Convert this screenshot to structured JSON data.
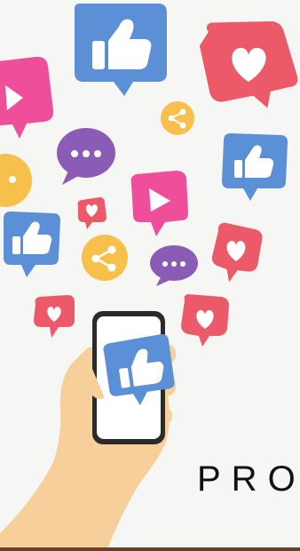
{
  "title": "PRO",
  "colors": {
    "background": "#f6f6f4",
    "blue": "#5b8fd6",
    "red": "#ec5a6a",
    "pink": "#ef4f9a",
    "purple": "#8b5cb6",
    "yellow": "#f7c04a",
    "skin": "#f6cf9a",
    "phone_frame": "#2b2b2b",
    "text": "#111111"
  },
  "icons": [
    "thumbs-up-icon",
    "heart-icon",
    "play-icon",
    "share-icon",
    "chat-dots-icon",
    "smartphone-icon",
    "hand-icon"
  ]
}
